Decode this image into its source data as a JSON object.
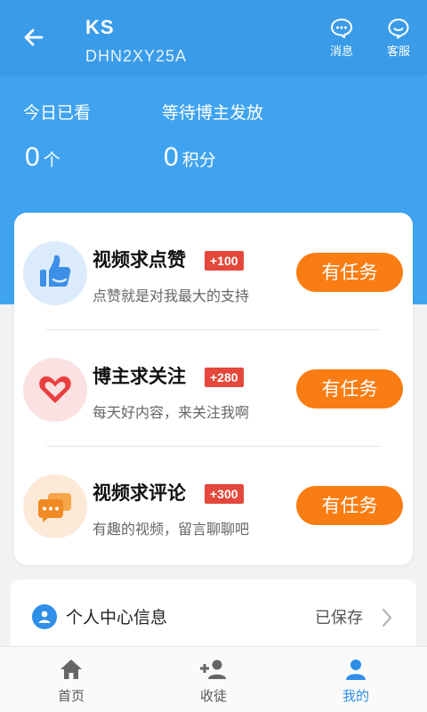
{
  "header": {
    "title": "KS",
    "subtitle": "DHN2XY25A",
    "message_label": "消息",
    "service_label": "客服"
  },
  "stats": {
    "today_label": "今日已看",
    "today_value": "0",
    "today_unit": "个",
    "pending_label": "等待博主发放",
    "pending_value": "0",
    "pending_unit": "积分"
  },
  "tasks": [
    {
      "name": "视频求点赞",
      "badge": "+100",
      "desc": "点赞就是对我最大的支持",
      "button": "有任务",
      "icon": "thumbs-up-icon"
    },
    {
      "name": "博主求关注",
      "badge": "+280",
      "desc": "每天好内容，来关注我啊",
      "button": "有任务",
      "icon": "heart-icon"
    },
    {
      "name": "视频求评论",
      "badge": "+300",
      "desc": "有趣的视频，留言聊聊吧",
      "button": "有任务",
      "icon": "chat-bubbles-icon"
    }
  ],
  "profile_info": {
    "label": "个人中心信息",
    "status": "已保存",
    "icon": "user-icon"
  },
  "tabbar": {
    "items": [
      {
        "label": "首页",
        "icon": "home-icon",
        "active": false
      },
      {
        "label": "收徒",
        "icon": "add-user-icon",
        "active": false
      },
      {
        "label": "我的",
        "icon": "user-icon",
        "active": true
      }
    ]
  },
  "colors": {
    "primary": "#3a9ce9",
    "accent_button": "#f97d12",
    "badge": "#e4473b",
    "tab_active": "#2f8ee8"
  }
}
